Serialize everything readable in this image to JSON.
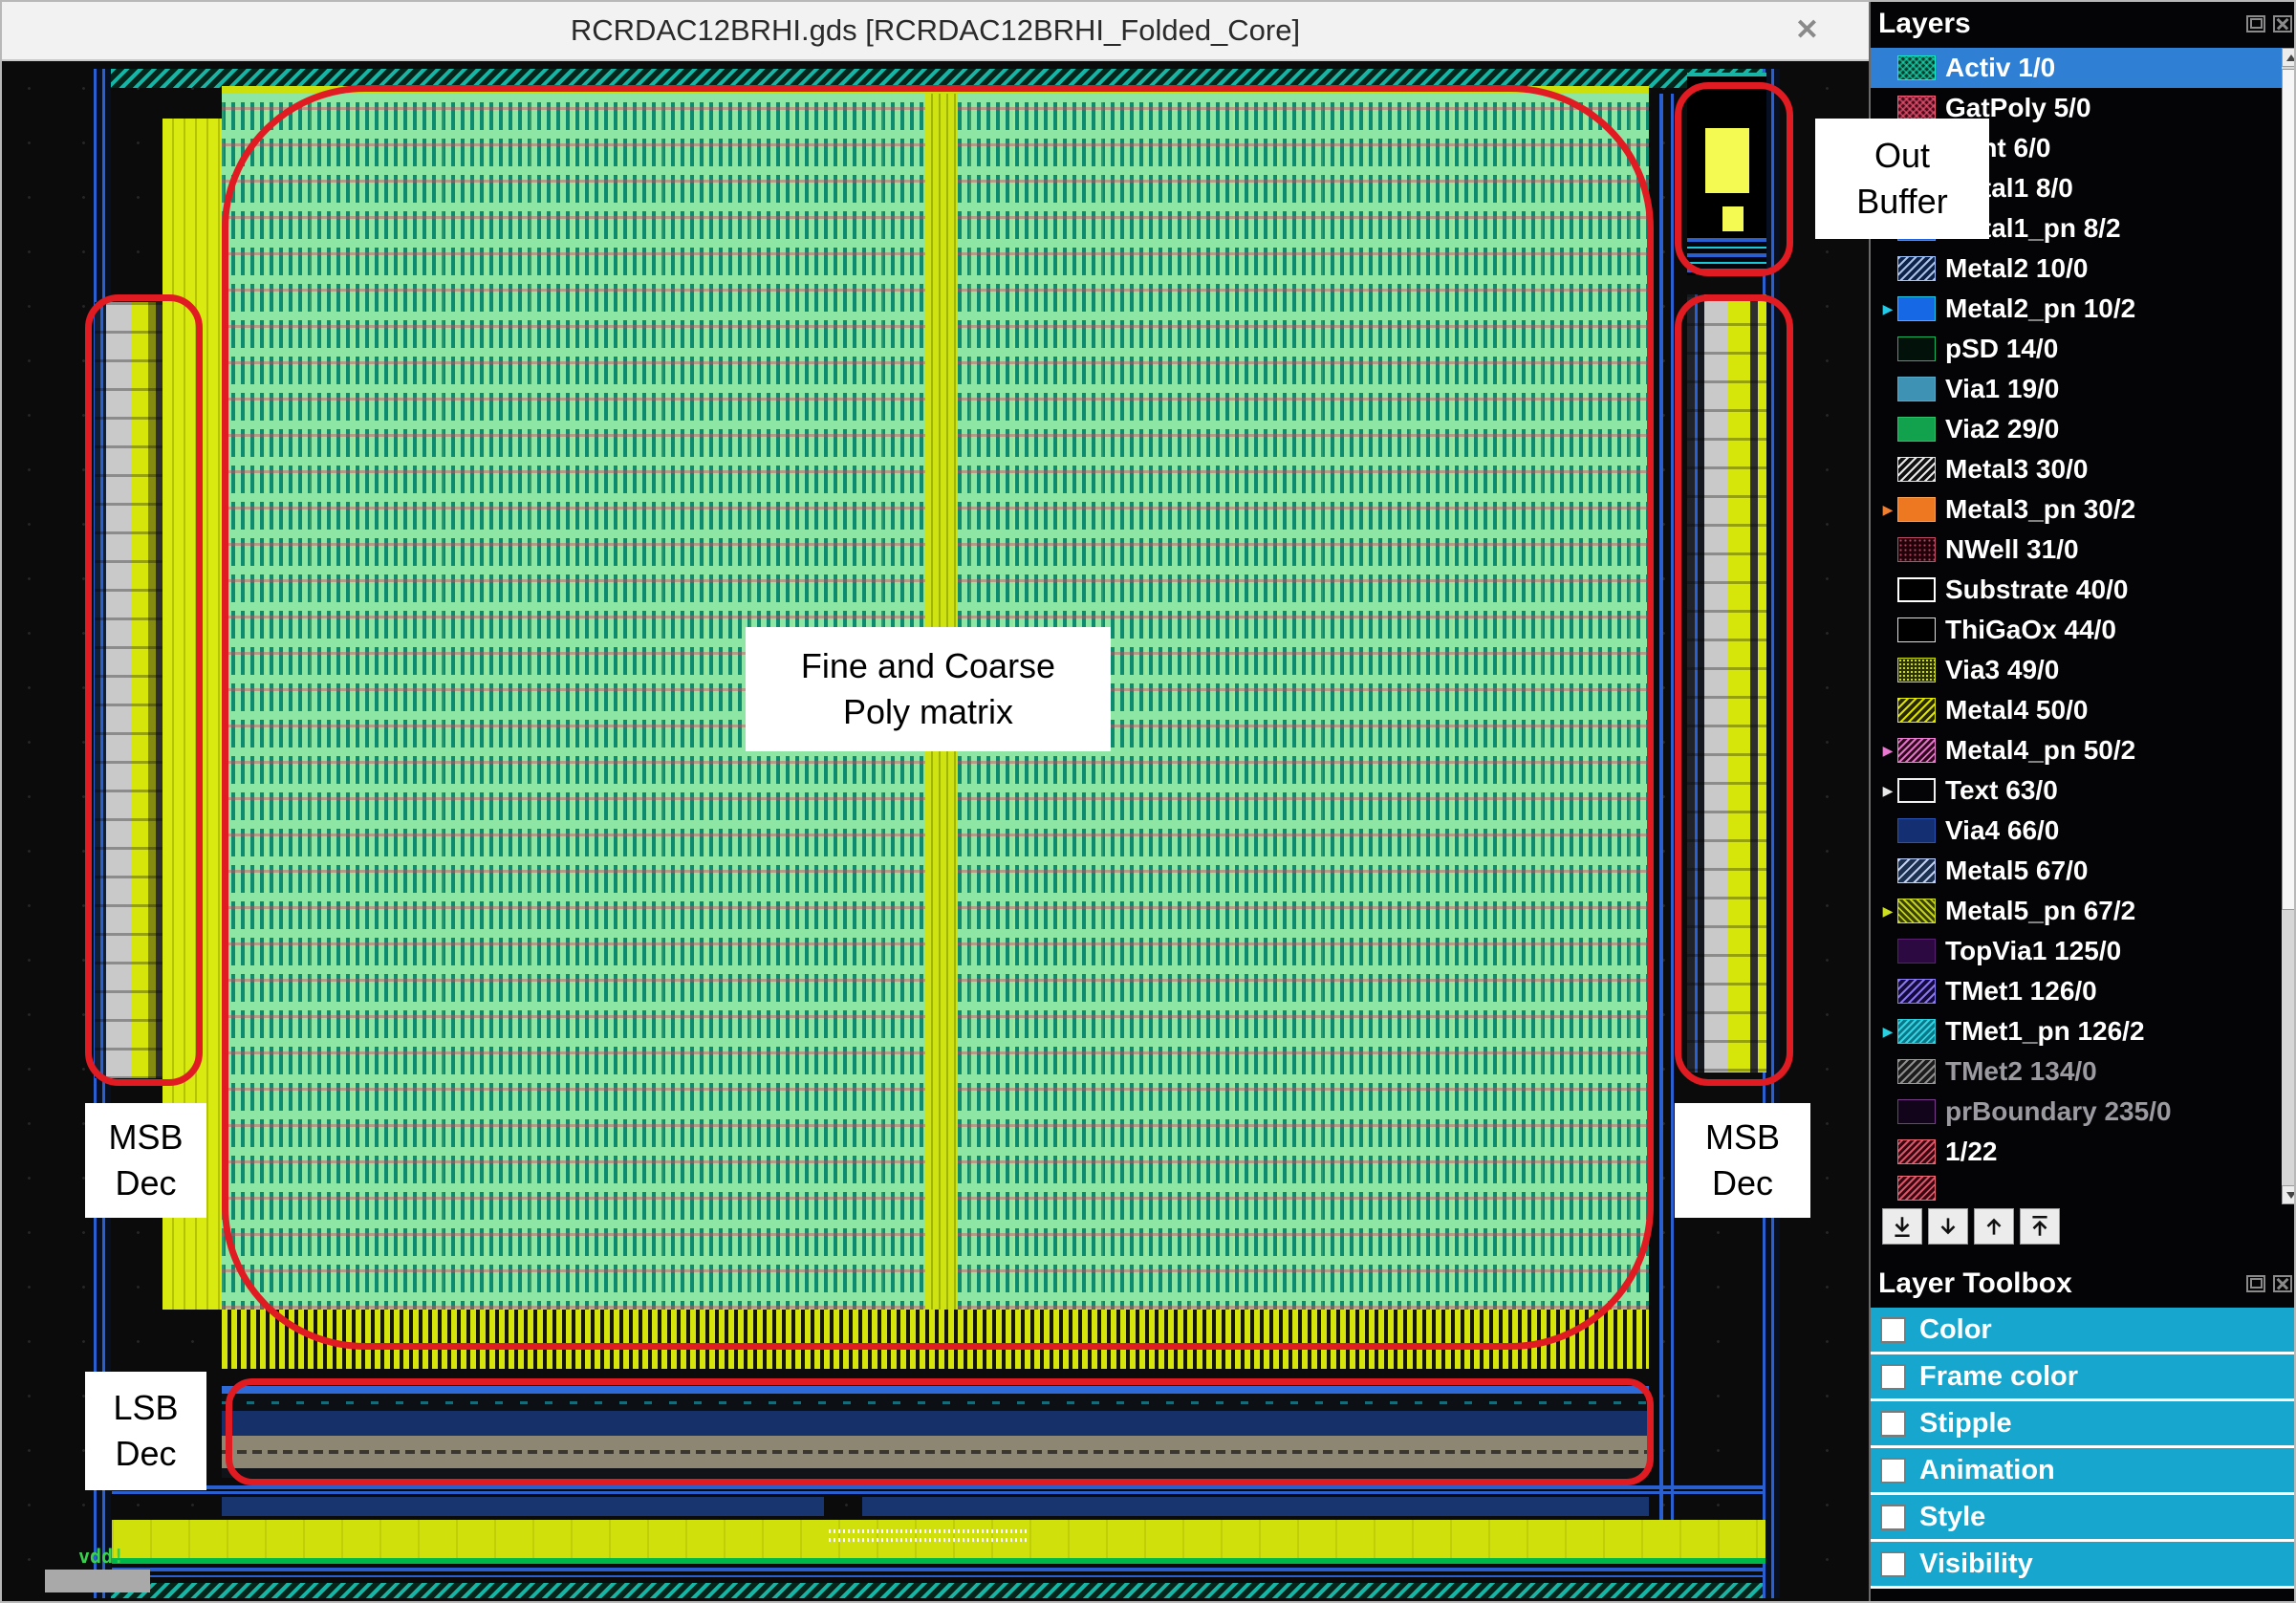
{
  "window": {
    "title": "RCRDAC12BRHI.gds [RCRDAC12BRHI_Folded_Core]",
    "close_icon": "✕"
  },
  "colors": {
    "selection_blue": "#2f80d4",
    "annotation_red": "#e11b22",
    "toolbox_cyan": "#16a6ce",
    "matrix_green": "#8ee6a4",
    "rail_yellow": "#cfe00a"
  },
  "canvas": {
    "vdd_label": "vdd!"
  },
  "annotations": {
    "fine_coarse": {
      "line1": "Fine and Coarse",
      "line2": "Poly matrix"
    },
    "msb_left": {
      "line1": "MSB",
      "line2": "Dec"
    },
    "msb_right": {
      "line1": "MSB",
      "line2": "Dec"
    },
    "lsb": {
      "line1": "LSB",
      "line2": "Dec"
    },
    "out_buffer": {
      "line1": "Out",
      "line2": "Buffer"
    }
  },
  "layers_panel": {
    "title": "Layers",
    "items": [
      {
        "label": "Activ 1/0",
        "swatch": "activ",
        "selected": true
      },
      {
        "label": "GatPoly 5/0",
        "swatch": "gatpoly"
      },
      {
        "label": "Cont 6/0",
        "swatch": "cont"
      },
      {
        "label": "Metal1 8/0",
        "swatch": "metal1"
      },
      {
        "label": "Metal1_pn 8/2",
        "swatch": "metal1pn",
        "marker": true
      },
      {
        "label": "Metal2 10/0",
        "swatch": "metal2"
      },
      {
        "label": "Metal2_pn 10/2",
        "swatch": "metal2pn",
        "marker": true
      },
      {
        "label": "pSD 14/0",
        "swatch": "psd"
      },
      {
        "label": "Via1 19/0",
        "swatch": "via1"
      },
      {
        "label": "Via2 29/0",
        "swatch": "via2"
      },
      {
        "label": "Metal3 30/0",
        "swatch": "metal3"
      },
      {
        "label": "Metal3_pn 30/2",
        "swatch": "metal3pn",
        "marker": true
      },
      {
        "label": "NWell 31/0",
        "swatch": "nwell"
      },
      {
        "label": "Substrate 40/0",
        "swatch": "substrate"
      },
      {
        "label": "ThiGaOx 44/0",
        "swatch": "thigaox"
      },
      {
        "label": "Via3 49/0",
        "swatch": "via3"
      },
      {
        "label": "Metal4 50/0",
        "swatch": "metal4"
      },
      {
        "label": "Metal4_pn 50/2",
        "swatch": "metal4pn",
        "marker": true
      },
      {
        "label": "Text 63/0",
        "swatch": "text",
        "marker": true
      },
      {
        "label": "Via4 66/0",
        "swatch": "via4"
      },
      {
        "label": "Metal5 67/0",
        "swatch": "metal5"
      },
      {
        "label": "Metal5_pn 67/2",
        "swatch": "metal5pn",
        "marker": true
      },
      {
        "label": "TopVia1 125/0",
        "swatch": "topvia1"
      },
      {
        "label": "TMet1 126/0",
        "swatch": "tmet1"
      },
      {
        "label": "TMet1_pn 126/2",
        "swatch": "tmet1pn",
        "marker": true
      },
      {
        "label": "TMet2 134/0",
        "swatch": "tmet2",
        "dimmed": true
      },
      {
        "label": "prBoundary 235/0",
        "swatch": "prboundary",
        "dimmed": true
      },
      {
        "label": "1/22",
        "swatch": "hatch-red"
      },
      {
        "label": "",
        "swatch": "hatch-red",
        "partial": true
      }
    ]
  },
  "toolbox": {
    "title": "Layer Toolbox",
    "items": [
      {
        "label": "Color"
      },
      {
        "label": "Frame color"
      },
      {
        "label": "Stipple"
      },
      {
        "label": "Animation"
      },
      {
        "label": "Style"
      },
      {
        "label": "Visibility"
      }
    ]
  }
}
